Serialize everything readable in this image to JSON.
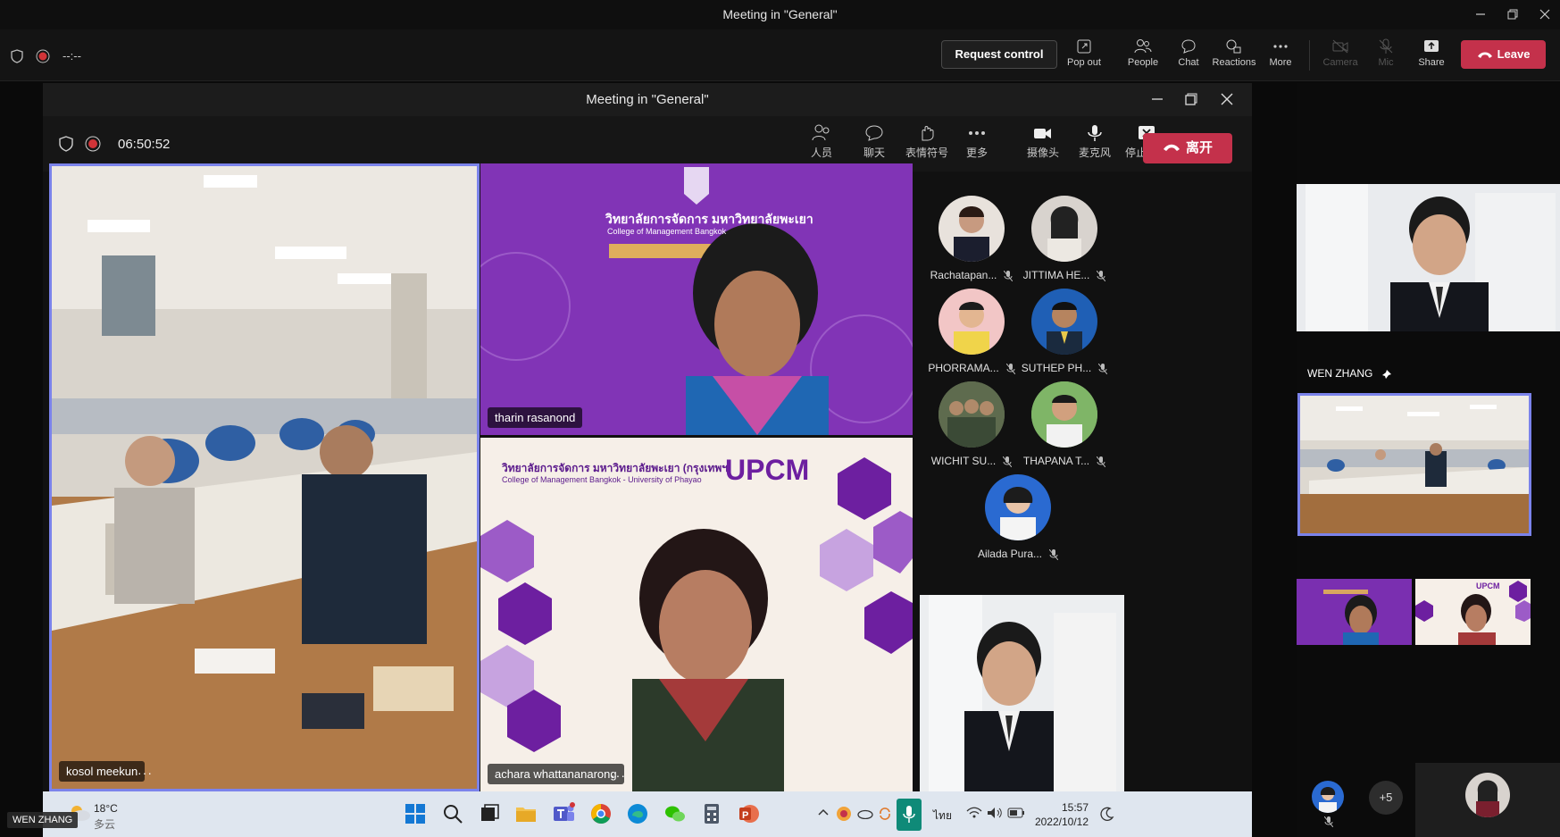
{
  "outer_window": {
    "title": "Meeting in \"General\"",
    "timer": "--:--",
    "request_control": "Request control",
    "toolbar": {
      "pop_out": "Pop out",
      "people": "People",
      "chat": "Chat",
      "reactions": "Reactions",
      "more": "More",
      "camera": "Camera",
      "mic": "Mic",
      "share": "Share",
      "leave": "Leave"
    }
  },
  "inner_window": {
    "title": "Meeting in \"General\"",
    "timer": "06:50:52",
    "toolbar": {
      "people": "人员",
      "chat": "聊天",
      "reactions": "表情符号",
      "more": "更多",
      "camera": "摄像头",
      "mic": "麦克风",
      "stop_share": "停止共享",
      "leave": "离开"
    }
  },
  "tiles": {
    "main": {
      "name": "kosol meekun"
    },
    "top_center": {
      "name": "tharin rasanond",
      "banner_thai": "วิทยาลัยการจัดการ มหาวิทยาลัยพะเยา",
      "banner_en": "College of Management Bangkok"
    },
    "bottom_center": {
      "name": "achara whattananarong",
      "banner_thai": "วิทยาลัยการจัดการ มหาวิทยาลัยพะเยา (กรุงเทพฯ)",
      "banner_en": "College of Management Bangkok - University of Phayao",
      "logo": "UPCM"
    }
  },
  "participants": [
    {
      "name": "Rachatapan..."
    },
    {
      "name": "JITTIMA HE..."
    },
    {
      "name": "PHORRAMA..."
    },
    {
      "name": "SUTHEP PH..."
    },
    {
      "name": "WICHIT SU..."
    },
    {
      "name": "THAPANA T..."
    },
    {
      "name": "Ailada Pura..."
    }
  ],
  "right_panel": {
    "presenter_name": "WEN ZHANG",
    "thumb_logo": "UPCM",
    "overflow": "+5"
  },
  "taskbar": {
    "weather_temp": "18°C",
    "weather_desc": "多云",
    "lang": "ไทย",
    "time": "15:57",
    "date": "2022/10/12"
  },
  "self_label": "WEN ZHANG",
  "colors": {
    "leave_red": "#c4314b",
    "active_border": "#7b83eb",
    "purple_bg": "#7a2fb0"
  }
}
